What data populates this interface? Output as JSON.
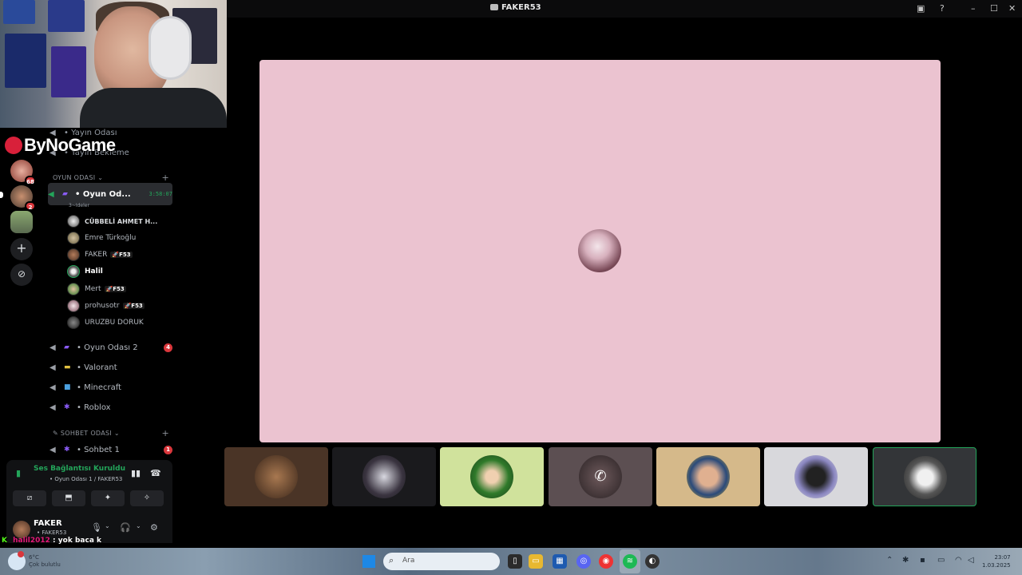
{
  "window": {
    "title": "FAKER53",
    "controls": [
      "inbox-icon",
      "help-icon",
      "minimize-icon",
      "maximize-icon",
      "close-icon"
    ]
  },
  "overlay": {
    "brand": "ByNoGame",
    "chat": {
      "user": "halil2012",
      "separator": " : ",
      "message": "yok baca k"
    }
  },
  "servers": [
    {
      "name": "server-1",
      "badge": "68"
    },
    {
      "name": "server-2",
      "badge": "2"
    },
    {
      "name": "server-3",
      "badge": ""
    }
  ],
  "channels": {
    "top_items": [
      "• Yayın Odası",
      "• Yayın Bekleme"
    ],
    "category_game": "OYUN ODASI ⌄",
    "active": {
      "name": "• Oyun Od...",
      "timer": "3:58:07",
      "sub": "3~Ideler"
    },
    "members": [
      {
        "name": "CÜBBELİ AHMET H...",
        "tag": ""
      },
      {
        "name": "Emre Türkoğlu",
        "tag": ""
      },
      {
        "name": "FAKER",
        "tag": "F53"
      },
      {
        "name": "Halil",
        "tag": ""
      },
      {
        "name": "Mert",
        "tag": "F53"
      },
      {
        "name": "prohusotr",
        "tag": "F53"
      },
      {
        "name": "URUZBU DORUK",
        "tag": ""
      }
    ],
    "voice_channels": [
      {
        "name": "• Oyun Odası 2",
        "badge": "4"
      },
      {
        "name": "• Valorant",
        "badge": ""
      },
      {
        "name": "• Minecraft",
        "badge": ""
      },
      {
        "name": "• Roblox",
        "badge": ""
      }
    ],
    "category_chat": "SOHBET ODASI ⌄",
    "chat_channels": [
      {
        "name": "• Sohbet 1",
        "badge": "1"
      }
    ]
  },
  "voice_panel": {
    "status": "Ses Bağlantısı Kuruldu",
    "channel": "• Oyun Odası 1 / FAKER53"
  },
  "user_panel": {
    "name": "FAKER",
    "tag": "• FAKER53"
  },
  "taskbar": {
    "weather": "6°C\nÇok bulutlu",
    "search_placeholder": "Ara",
    "time": "23:07",
    "date": "1.03.2025"
  },
  "colors": {
    "focus_tile_bg": "#ebc3d0",
    "speaking_green": "#23a55a",
    "badge_red": "#da373c"
  }
}
